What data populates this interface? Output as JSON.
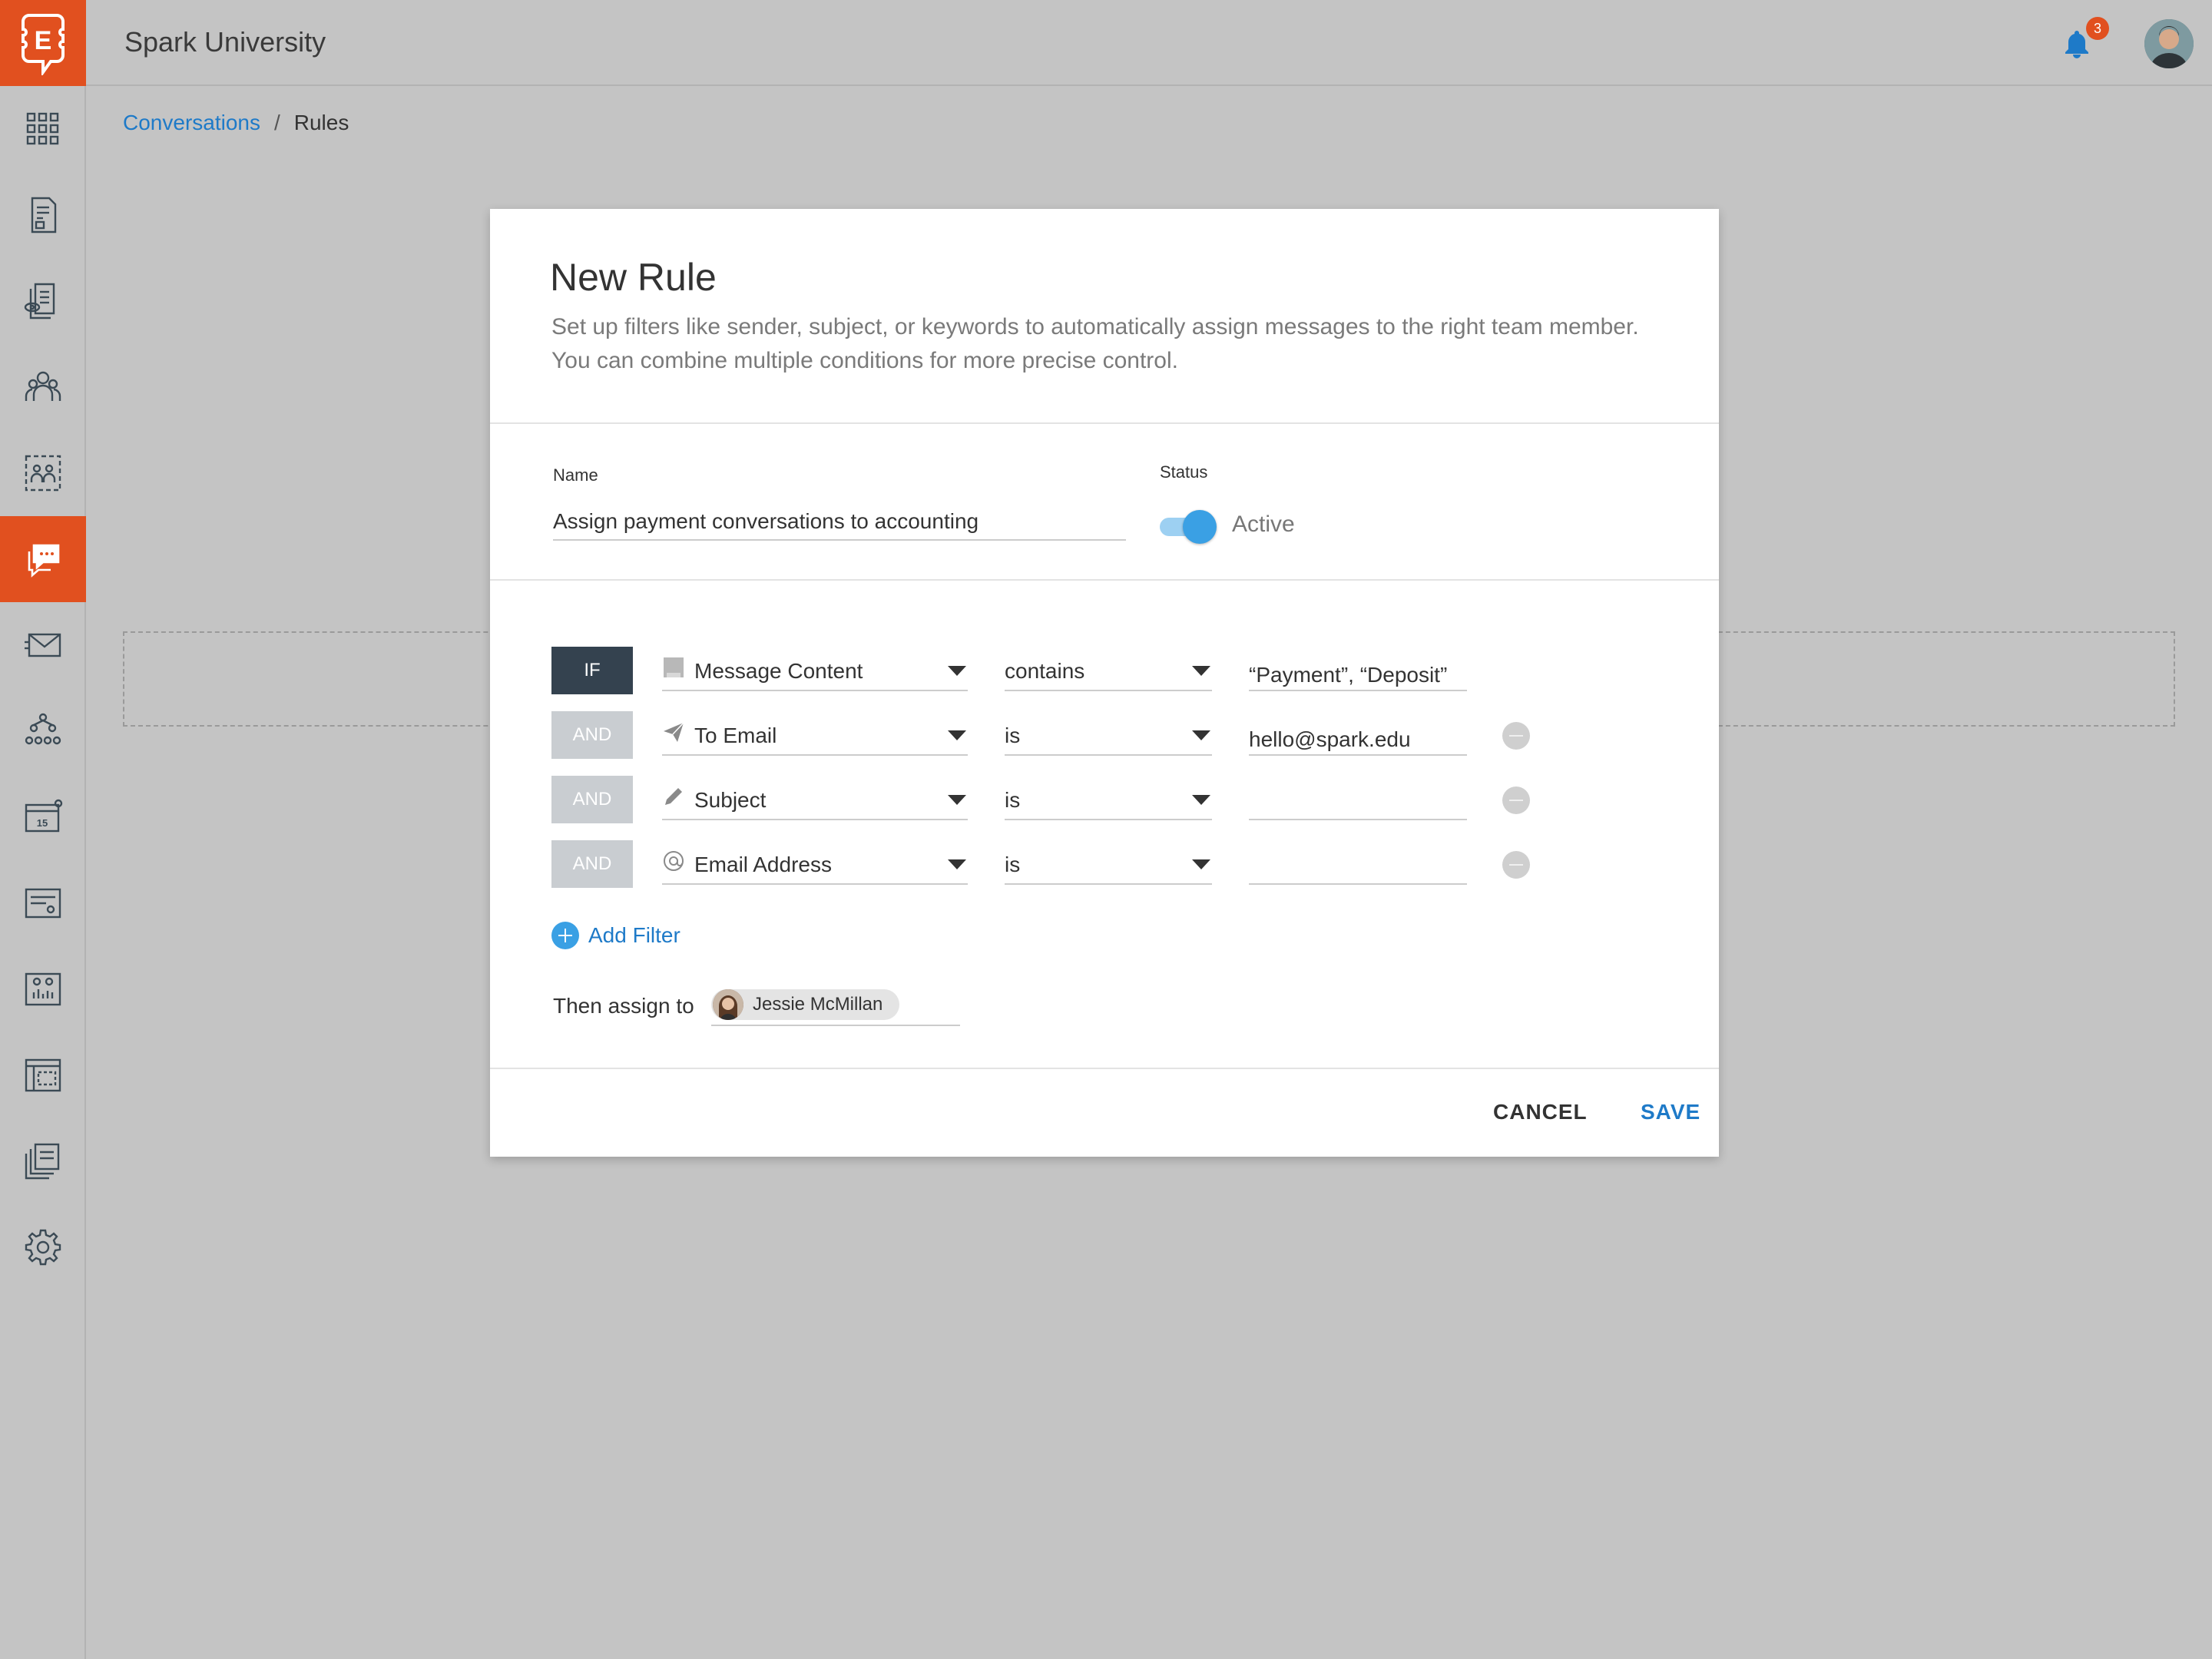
{
  "header": {
    "app_title": "Spark University",
    "notification_count": "3"
  },
  "sidebar": {
    "logo_letter": "E",
    "items": [
      {
        "icon": "apps-grid-icon"
      },
      {
        "icon": "document-icon"
      },
      {
        "icon": "document-review-icon"
      },
      {
        "icon": "people-icon"
      },
      {
        "icon": "group-select-icon"
      },
      {
        "icon": "conversations-icon",
        "active": true
      },
      {
        "icon": "mail-icon"
      },
      {
        "icon": "hierarchy-icon"
      },
      {
        "icon": "calendar-icon",
        "text": "15"
      },
      {
        "icon": "forms-icon"
      },
      {
        "icon": "reports-icon"
      },
      {
        "icon": "layout-icon"
      },
      {
        "icon": "files-icon"
      },
      {
        "icon": "settings-icon"
      }
    ]
  },
  "breadcrumb": {
    "parent": "Conversations",
    "separator": "/",
    "current": "Rules"
  },
  "modal": {
    "title": "New Rule",
    "description_line1": "Set up filters like sender, subject, or keywords to automatically assign messages to the right team member.",
    "description_line2": "You can combine multiple conditions for more precise control.",
    "name_label": "Name",
    "name_value": "Assign payment conversations to accounting",
    "status_label": "Status",
    "status_value": "Active",
    "status_on": true,
    "filters": [
      {
        "op": "IF",
        "field": "Message Content",
        "field_icon": "message-content-icon",
        "operator": "contains",
        "value": "“Payment”, “Deposit”",
        "removable": false
      },
      {
        "op": "AND",
        "field": "To Email",
        "field_icon": "send-icon",
        "operator": "is",
        "value": "hello@spark.edu",
        "removable": true
      },
      {
        "op": "AND",
        "field": "Subject",
        "field_icon": "pencil-icon",
        "operator": "is",
        "value": "",
        "removable": true
      },
      {
        "op": "AND",
        "field": "Email Address",
        "field_icon": "at-icon",
        "operator": "is",
        "value": "",
        "removable": true
      }
    ],
    "add_filter_label": "Add Filter",
    "assign_label": "Then assign to",
    "assignee": "Jessie McMillan",
    "cancel_label": "CANCEL",
    "save_label": "SAVE"
  },
  "colors": {
    "accent": "#e1501f",
    "link": "#1e7ac8",
    "toggle": "#3aa0e4",
    "if_badge": "#34424f",
    "and_badge": "#c9cdd1"
  }
}
